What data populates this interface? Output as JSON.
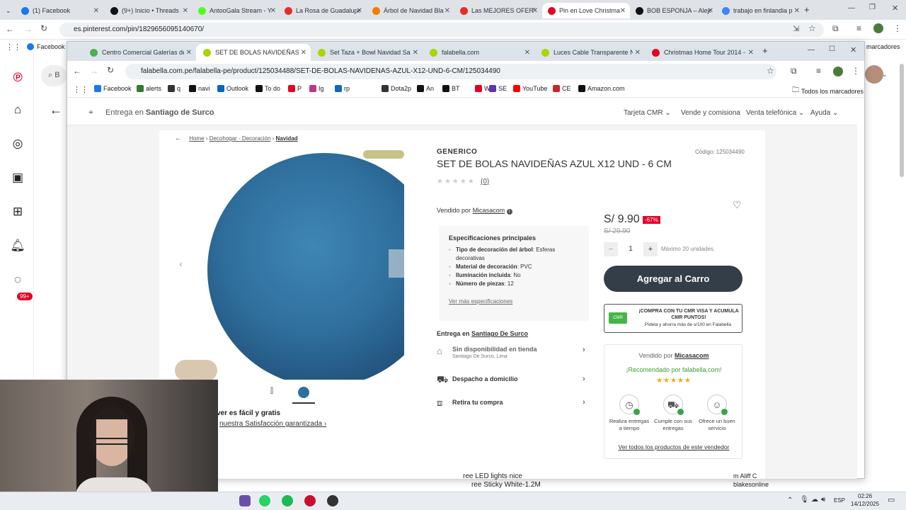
{
  "outer": {
    "tabs": [
      {
        "label": "(1) Facebook",
        "color": "#1877f2"
      },
      {
        "label": "(9+) Inicio • Threads",
        "color": "#111111"
      },
      {
        "label": "AntooGala Stream - Y",
        "color": "#53fc18"
      },
      {
        "label": "La Rosa de Guadalupe",
        "color": "#e52d27"
      },
      {
        "label": "Árbol de Navidad Bla",
        "color": "#f57c00"
      },
      {
        "label": "Las MEJORES OFERTA",
        "color": "#e52d27"
      },
      {
        "label": "Pin en Love Christma",
        "color": "#e60023"
      },
      {
        "label": "BOB ESPONJA – Aleje",
        "color": "#111111"
      },
      {
        "label": "trabajo en finlandia p",
        "color": "#4285f4"
      }
    ],
    "url": "es.pinterest.com/pin/1829656095140670/",
    "bookmark_facebook": "Facebook",
    "bookmark_right": "marcadores",
    "search_letter": "B",
    "notifications_badge": "99+"
  },
  "inner": {
    "tabs": [
      {
        "label": "Centro Comercial Galerías de M",
        "color": "#4caf50"
      },
      {
        "label": "SET DE BOLAS NAVIDEÑAS AZUL",
        "color": "#aad500"
      },
      {
        "label": "Set Taza + Bowl Navidad Santa",
        "color": "#aad500"
      },
      {
        "label": "falabella.com",
        "color": "#aad500"
      },
      {
        "label": "Luces Cable Transparente Navi",
        "color": "#aad500"
      },
      {
        "label": "Christmas Home Tour 2014 - Th",
        "color": "#e60023"
      }
    ],
    "url": "falabella.com.pe/falabella-pe/product/125034488/SET-DE-BOLAS-NAVIDENAS-AZUL-X12-UND-6-CM/125034490",
    "bookmarks": [
      {
        "label": "Facebook",
        "color": "#1877f2"
      },
      {
        "label": "alerts",
        "color": "#2e7d32"
      },
      {
        "label": "q",
        "color": "#333333"
      },
      {
        "label": "navi",
        "color": "#111111"
      },
      {
        "label": "Outlook",
        "color": "#0a64c8"
      },
      {
        "label": "To do",
        "color": "#111111"
      },
      {
        "label": "P",
        "color": "#e60023"
      },
      {
        "label": "Ig",
        "color": "#c13584"
      },
      {
        "label": "rp",
        "color": "#1565c0"
      },
      {
        "label": "Dota2p",
        "color": "#333333"
      },
      {
        "label": "An",
        "color": "#111111"
      },
      {
        "label": "BT",
        "color": "#111111"
      },
      {
        "label": "W",
        "color": "#e60023"
      },
      {
        "label": "SE",
        "color": "#5e35b1"
      },
      {
        "label": "YouTube",
        "color": "#ff0000"
      },
      {
        "label": "CE",
        "color": "#c62828"
      },
      {
        "label": "Amazon.com",
        "color": "#111111"
      }
    ],
    "all_bookmarks": "Todos los marcadores"
  },
  "site": {
    "delivery_prefix": "Entrega en",
    "delivery_place": "Santiago de Surco",
    "nav": [
      "Tarjeta CMR",
      "Vende y comisiona",
      "Venta telefónica",
      "Ayuda"
    ]
  },
  "breadcrumb": {
    "home": "Home",
    "cat": "Decohogar - Decoración",
    "sub": "Navidad"
  },
  "product": {
    "brand": "GENERICO",
    "title": "SET DE BOLAS NAVIDEÑAS AZUL X12 UND - 6 CM",
    "code": "Código: 125034490",
    "reviews": "(0)",
    "seller_prefix": "Vendido por",
    "seller": "Micasacom",
    "price": "S/ 9.90",
    "discount": "-67%",
    "old_price": "S/ 29.90",
    "qty": "1",
    "max_units": "Máximo 20 unidades.",
    "add_to_cart": "Agregar al Carro",
    "cmr_title": "¡COMPRA CON TU CMR VISA Y ACUMULA CMR PUNTOS!",
    "cmr_sub": "Pídela y ahorra más de s/100 en Falabella"
  },
  "specs": {
    "title": "Especificaciones principales",
    "items": [
      {
        "k": "Tipo de decoración del árbol",
        "v": ": Esferas decorativas"
      },
      {
        "k": "Material de decoración",
        "v": ": PVC"
      },
      {
        "k": "Iluminación incluida",
        "v": ": No"
      },
      {
        "k": "Número de piezas",
        "v": ": 12"
      }
    ],
    "more": "Ver más especificaciones"
  },
  "delivery": {
    "prefix": "Entrega en",
    "place": "Santiago De Surco",
    "rows": [
      {
        "title": "Sin disponibilidad en tienda",
        "sub": "Santiago De Surco, Lima"
      },
      {
        "title": "Despacho a domicilio",
        "sub": ""
      },
      {
        "title": "Retira tu compra",
        "sub": ""
      }
    ]
  },
  "seller_box": {
    "prefix": "Vendido por",
    "seller": "Micasacom",
    "recommended": "¡Recomendado por falabella.com!",
    "stars": 5,
    "badges": [
      "Realiza entregas a tiempo",
      "Cumple con sus entregas",
      "Ofrece un buen servicio"
    ],
    "link": "Ver todos los productos de este vendedor"
  },
  "behind": {
    "satisfaction_1": "ver es fácil y gratis",
    "satisfaction_2": "nuestra Satisfacción garantizada",
    "lights_1": "ree Sticky White-1.2M",
    "lights_0": "ree LED lights nice",
    "seller_2a": "m Aliff C",
    "seller_2b": "blakesonline"
  },
  "taskbar": {
    "lang": "ESP",
    "time": "02:26",
    "date": "14/12/2025"
  }
}
